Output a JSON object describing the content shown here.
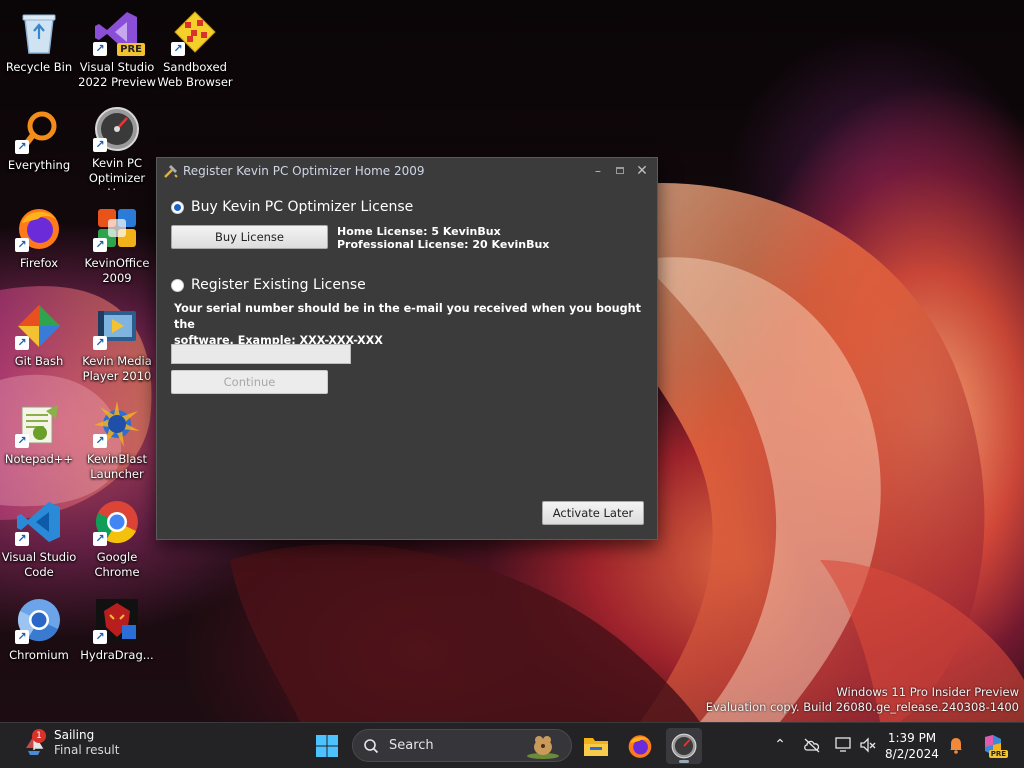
{
  "desktop": {
    "icons": [
      {
        "label": "Recycle Bin",
        "icon": "recycle-bin-icon"
      },
      {
        "label": "Visual Studio\n2022 Preview",
        "icon": "visual-studio-preview-icon",
        "badge": "PRE"
      },
      {
        "label": "Sandboxed\nWeb Browser",
        "icon": "sandboxed-browser-icon"
      },
      {
        "label": "Everything",
        "icon": "everything-search-icon"
      },
      {
        "label": "Kevin PC\nOptimizer H...",
        "icon": "optimizer-gauge-icon"
      },
      {
        "label": "Firefox",
        "icon": "firefox-icon"
      },
      {
        "label": "KevinOffice\n2009",
        "icon": "kevinoffice-icon"
      },
      {
        "label": "Git Bash",
        "icon": "git-bash-icon"
      },
      {
        "label": "Kevin Media\nPlayer 2010",
        "icon": "media-player-icon"
      },
      {
        "label": "Notepad++",
        "icon": "notepad-plus-plus-icon"
      },
      {
        "label": "KevinBlast\nLauncher",
        "icon": "kevinblast-icon"
      },
      {
        "label": "Visual Studio\nCode",
        "icon": "vscode-icon"
      },
      {
        "label": "Google\nChrome",
        "icon": "chrome-icon"
      },
      {
        "label": "Chromium",
        "icon": "chromium-icon"
      },
      {
        "label": "HydraDrag...",
        "icon": "hydradragon-icon"
      }
    ]
  },
  "dialog": {
    "title": "Register Kevin PC Optimizer Home 2009",
    "buy_option_label": "Buy Kevin PC Optimizer License",
    "buy_button": "Buy License",
    "price_home": "Home License: 5 KevinBux",
    "price_pro": "Professional License: 20 KevinBux",
    "register_option_label": "Register Existing License",
    "serial_help_line1": "Your serial number should be in the e-mail you received when you bought the",
    "serial_help_line2": "software. Example: XXX-XXX-XXX",
    "serial_value": "",
    "continue_button": "Continue",
    "activate_later_button": "Activate Later",
    "selected_option": "buy"
  },
  "watermark": {
    "line1": "Windows 11 Pro Insider Preview",
    "line2": "Evaluation copy. Build 26080.ge_release.240308-1400"
  },
  "taskbar": {
    "weather_title": "Sailing",
    "weather_sub": "Final result",
    "weather_badge": "1",
    "search_placeholder": "Search",
    "clock_time": "1:39 PM",
    "clock_date": "8/2/2024",
    "copilot_badge": "PRE"
  }
}
